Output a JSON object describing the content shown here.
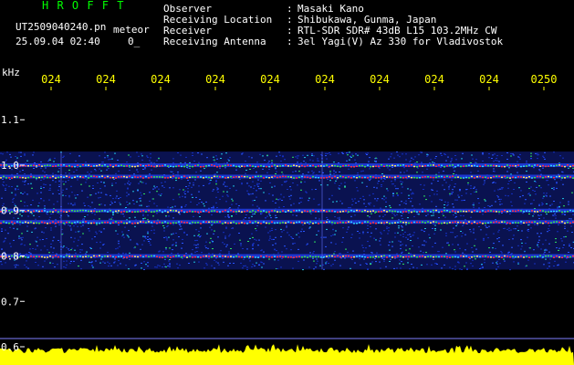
{
  "header": {
    "app_title": "H R O F F T",
    "filename": "UT2509040240.pn",
    "meteor_label": "meteor",
    "datetime": "25.09.04 02:40",
    "counter": "0_",
    "fields": [
      {
        "key": "Observer",
        "value": "Masaki Kano"
      },
      {
        "key": "Receiving Location",
        "value": "Shibukawa, Gunma, Japan"
      },
      {
        "key": "Receiver",
        "value": "RTL-SDR SDR# 43dB L15 103.2MHz CW"
      },
      {
        "key": "Receiving Antenna",
        "value": "3el Yagi(V) Az 330 for Vladivostok"
      }
    ]
  },
  "colors": {
    "background": "#000000",
    "title_green": "#00ff00",
    "tick_x": "#ffff00",
    "tick_y": "#ffffff",
    "band_blue": "#1f3bdc",
    "band_hot": "#ff3040",
    "noise_yellow": "#ffff00",
    "threshold_line": "#8080ff"
  },
  "axis": {
    "y_unit": "kHz",
    "y_ticks": [
      "1.1",
      "1.0",
      "0.9",
      "0.8",
      "0.7",
      "0.6"
    ],
    "x_ticks": [
      "024",
      "024",
      "024",
      "024",
      "024",
      "024",
      "024",
      "024",
      "024",
      "0250"
    ]
  },
  "spectrogram": {
    "freq_range_khz": [
      0.6,
      1.12
    ],
    "active_band_khz": [
      0.77,
      1.03
    ],
    "bright_lines_khz": [
      1.0,
      0.975,
      0.9,
      0.875,
      0.8
    ]
  }
}
